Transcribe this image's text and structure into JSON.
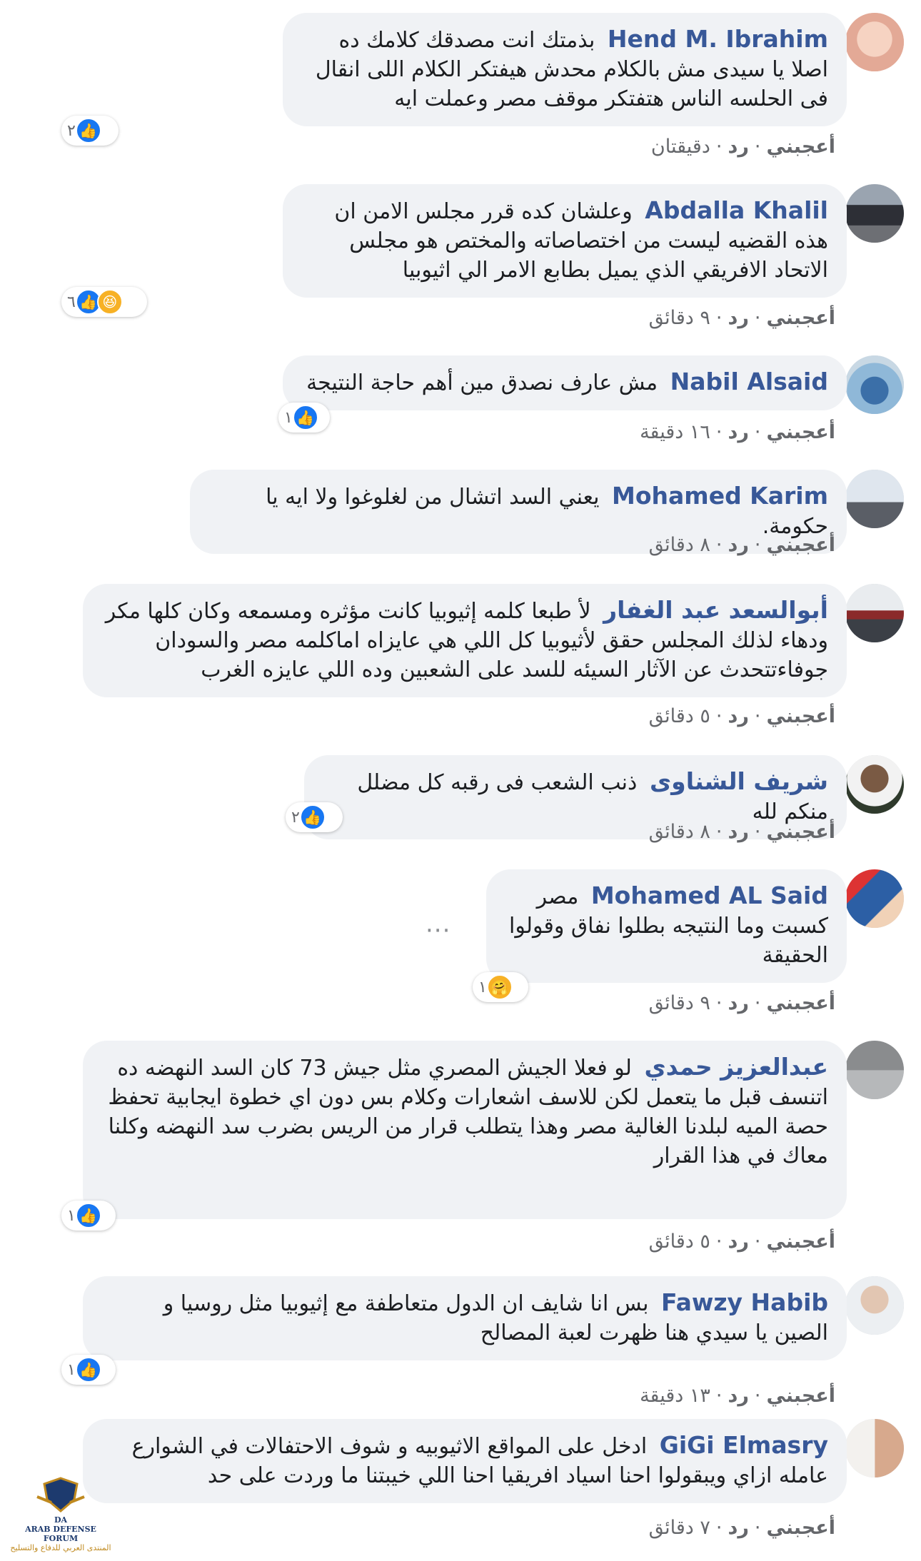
{
  "actions": {
    "like": "أعجبني",
    "reply": "رد"
  },
  "comments": [
    {
      "name": "Hend M. Ibrahim",
      "text": "بذمتك انت مصدقك كلامك ده اصلا يا سيدى مش بالكلام محدش هيفتكر الكلام اللى انقال فى الحلسه الناس هتفتكر موقف مصر وعملت ايه",
      "time": "دقيقتان",
      "reaction_count": "٢",
      "reactions": [
        "like-icon"
      ]
    },
    {
      "name": "Abdalla Khalil",
      "text": "وعلشان كده قرر مجلس الامن ان هذه القضيه ليست من اختصاصاته والمختص هو مجلس الاتحاد الافريقي الذي يميل بطابع الامر الي اثيوبيا",
      "time": "٩ دقائق",
      "reaction_count": "٦",
      "reactions": [
        "like-icon",
        "haha-icon"
      ]
    },
    {
      "name": "Nabil Alsaid",
      "text": "مش عارف نصدق مين أهم حاجة النتيجة",
      "time": "١٦ دقيقة",
      "reaction_count": "١",
      "reactions": [
        "like-icon"
      ]
    },
    {
      "name": "Mohamed Karim",
      "text": "يعني السد اتشال من لغلوغوا ولا ايه يا حكومة.",
      "time": "٨ دقائق",
      "reaction_count": "",
      "reactions": []
    },
    {
      "name": "أبوالسعد عبد الغفار",
      "text": "لأ طبعا كلمه إثيوبيا كانت مؤثره ومسمعه وكان كلها مكر ودهاء لذلك المجلس حقق لأثيوبيا كل اللي هي عايزاه اماكلمه مصر والسودان جوفاءتتحدث عن الآثار السيئه للسد على الشعبين وده اللي عايزه الغرب",
      "time": "٥ دقائق",
      "reaction_count": "",
      "reactions": []
    },
    {
      "name": "شريف الشناوى",
      "text": "ذنب الشعب فى رقبه كل مضلل منكم لله",
      "time": "٨ دقائق",
      "reaction_count": "٢",
      "reactions": [
        "like-icon"
      ]
    },
    {
      "name": "Mohamed AL Said",
      "text": "مصر كسبت وما النتيجه بطلوا نفاق وقولوا الحقيقة",
      "time": "٩ دقائق",
      "reaction_count": "١",
      "reactions": [
        "care-icon"
      ]
    },
    {
      "name": "عبدالعزيز حمدي",
      "text": "لو فعلا الجيش المصري مثل جيش 73 كان السد النهضه ده اتنسف قبل ما يتعمل لكن للاسف اشعارات وكلام بس دون اي خطوة ايجابية تحفظ حصة الميه لبلدنا الغالية مصر وهذا يتطلب قرار من الريس بضرب سد النهضه وكلنا معاك في هذا القرار",
      "time": "٥ دقائق",
      "reaction_count": "١",
      "reactions": [
        "like-icon"
      ]
    },
    {
      "name": "Fawzy Habib",
      "text": "بس انا شايف ان الدول متعاطفة مع إثيوبيا مثل روسيا و الصين يا سيدي هنا ظهرت لعبة المصالح",
      "time": "١٣ دقيقة",
      "reaction_count": "١",
      "reactions": [
        "like-icon"
      ]
    },
    {
      "name": "GiGi Elmasry",
      "text": "ادخل على المواقع الاثيوبيه و شوف الاحتفالات في الشوارع عامله ازاي ويبقولوا احنا اسياد افريقيا احنا اللي خيبتنا ما وردت على حد",
      "time": "٧ دقائق",
      "reaction_count": "",
      "reactions": []
    }
  ],
  "watermark": {
    "abbr": "DA",
    "en": "ARAB DEFENSE FORUM",
    "ar": "المنتدى العربي للدفاع والتسليح"
  },
  "colors": {
    "name": "#385898",
    "bubble": "#f0f2f5",
    "meta": "#65676b",
    "like": "#1877f2"
  }
}
